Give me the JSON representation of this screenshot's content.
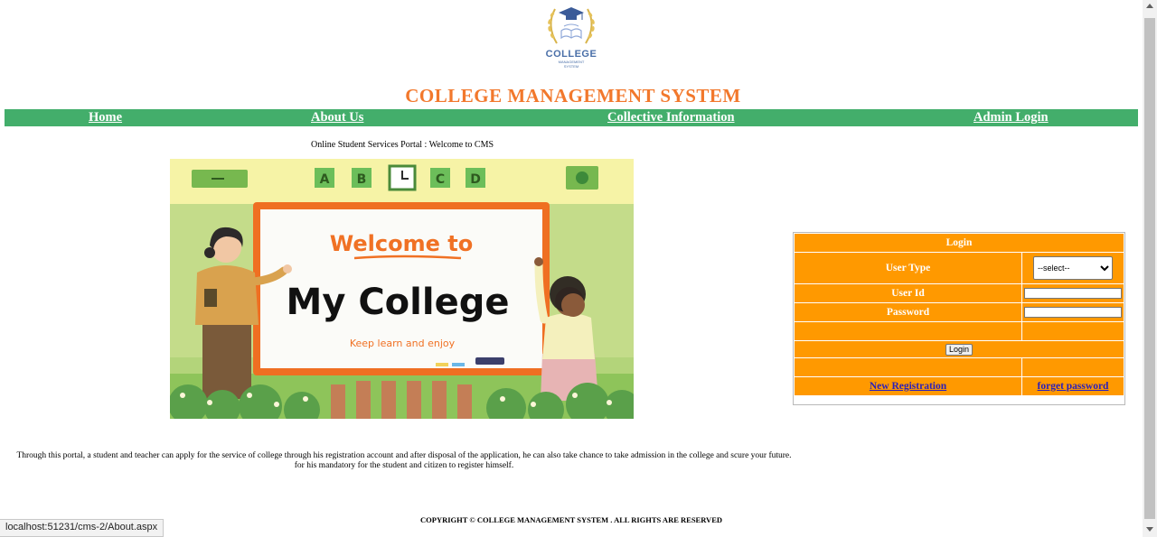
{
  "logo": {
    "icon": "graduation-cap-laurel-icon",
    "title": "COLLEGE",
    "subtitle_line1": "MANAGEMENT",
    "subtitle_line2": "SYSTEM"
  },
  "site_title": "COLLEGE MANAGEMENT SYSTEM",
  "nav": {
    "home": "Home",
    "about": "About Us",
    "collective": "Collective Information",
    "admin": "Admin Login"
  },
  "portal_welcome": "Online Student Services Portal : Welcome to CMS",
  "banner": {
    "heading": "Welcome to",
    "title": "My College",
    "tagline": "Keep learn and enjoy",
    "letters": [
      "A",
      "B",
      "C",
      "D"
    ]
  },
  "login": {
    "header": "Login",
    "user_type_label": "User Type",
    "user_type_selected": "--select--",
    "user_id_label": "User Id",
    "user_id_value": "",
    "password_label": "Password",
    "password_value": "",
    "button_label": "Login",
    "new_registration": "New Registration",
    "forget_password": "forget password"
  },
  "description": "Through this portal, a student and teacher can apply for the service of college through his registration account and after disposal  of the application, he can also take chance to take admission in the college and scure your future. for his mandatory for the student and citizen to register himself.",
  "footer": "COPYRIGHT © COLLEGE MANAGEMENT SYSTEM . ALL RIGHTS ARE RESERVED",
  "status_url": "localhost:51231/cms-2/About.aspx",
  "colors": {
    "title_orange": "#f2782c",
    "nav_green": "#43ae6b",
    "panel_orange": "#ff9900",
    "link_blue": "#2a1fbb"
  }
}
